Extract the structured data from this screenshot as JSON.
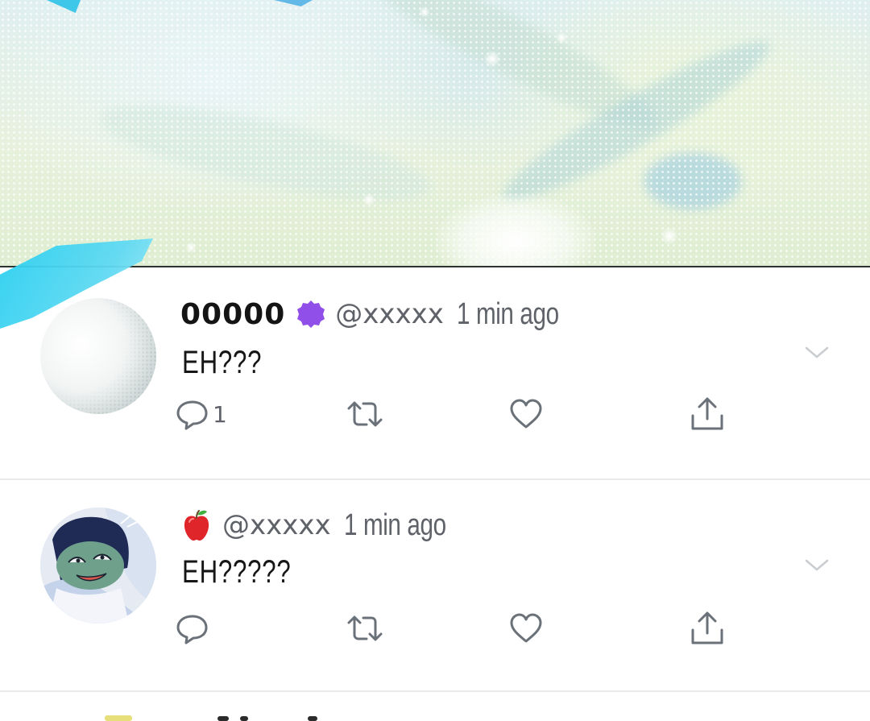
{
  "colors": {
    "text_primary": "#141414",
    "text_secondary": "#5f6268",
    "icon_gray": "#6b7178",
    "verified_purple": "#8f4fe8",
    "divider": "#e9eaec",
    "accent_blue": "#3fc7ea"
  },
  "tweets": [
    {
      "display_name": "00000",
      "badge_icon": "purple-verified-badge-icon",
      "handle": "@xxxxx",
      "timestamp": "1 min ago",
      "text": "EH???",
      "reply_count": "1",
      "icons": [
        "reply-icon",
        "retweet-icon",
        "like-icon",
        "share-icon",
        "chevron-down-icon"
      ]
    },
    {
      "display_name": "",
      "badge_icon": "apple-icon",
      "handle": "@xxxxx",
      "timestamp": "1 min ago",
      "text": "EH?????",
      "reply_count": "",
      "icons": [
        "reply-icon",
        "retweet-icon",
        "like-icon",
        "share-icon",
        "chevron-down-icon"
      ]
    }
  ]
}
